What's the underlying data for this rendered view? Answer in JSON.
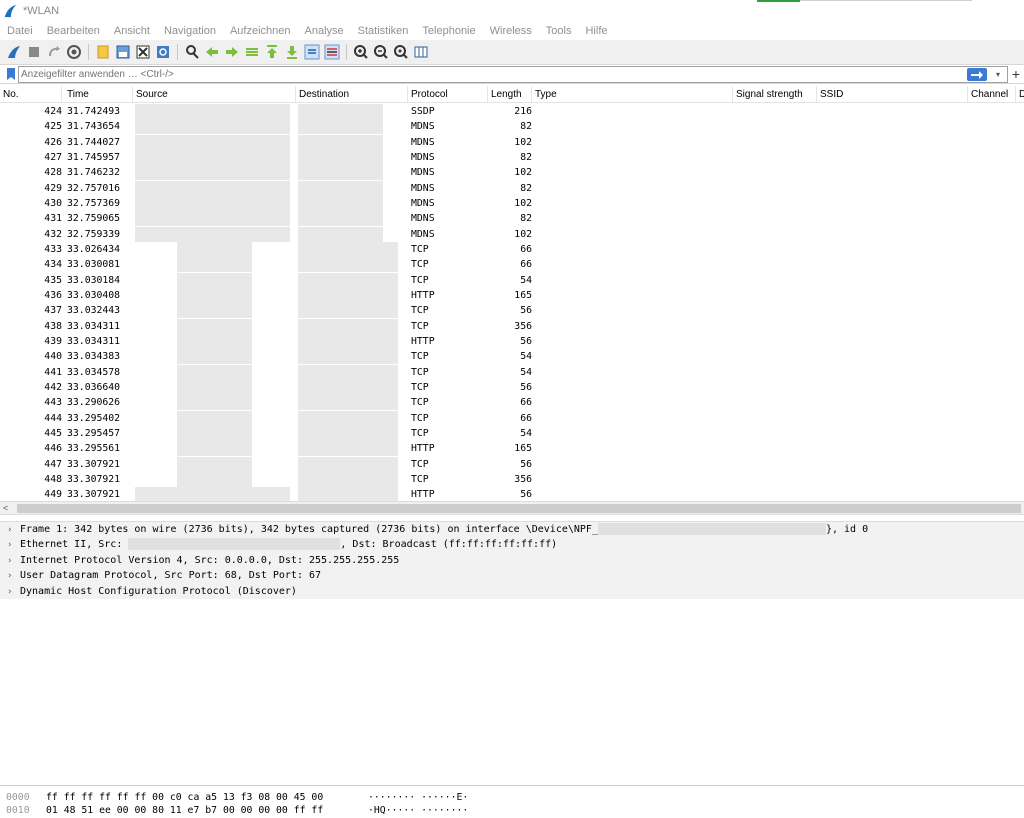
{
  "window": {
    "title": "*WLAN"
  },
  "menu": [
    "Datei",
    "Bearbeiten",
    "Ansicht",
    "Navigation",
    "Aufzeichnen",
    "Analyse",
    "Statistiken",
    "Telephonie",
    "Wireless",
    "Tools",
    "Hilfe"
  ],
  "filter": {
    "placeholder": "Anzeigefilter anwenden … <Ctrl-/>"
  },
  "columns": [
    "No.",
    "Time",
    "Source",
    "Destination",
    "Protocol",
    "Length",
    "Type",
    "Signal strength",
    "SSID",
    "Channel",
    "D"
  ],
  "packets": [
    {
      "no": "424",
      "time": "31.742493",
      "protocol": "SSDP",
      "length": "216"
    },
    {
      "no": "425",
      "time": "31.743654",
      "protocol": "MDNS",
      "length": "82"
    },
    {
      "no": "426",
      "time": "31.744027",
      "protocol": "MDNS",
      "length": "102"
    },
    {
      "no": "427",
      "time": "31.745957",
      "protocol": "MDNS",
      "length": "82"
    },
    {
      "no": "428",
      "time": "31.746232",
      "protocol": "MDNS",
      "length": "102"
    },
    {
      "no": "429",
      "time": "32.757016",
      "protocol": "MDNS",
      "length": "82"
    },
    {
      "no": "430",
      "time": "32.757369",
      "protocol": "MDNS",
      "length": "102"
    },
    {
      "no": "431",
      "time": "32.759065",
      "protocol": "MDNS",
      "length": "82"
    },
    {
      "no": "432",
      "time": "32.759339",
      "protocol": "MDNS",
      "length": "102"
    },
    {
      "no": "433",
      "time": "33.026434",
      "protocol": "TCP",
      "length": "66"
    },
    {
      "no": "434",
      "time": "33.030081",
      "protocol": "TCP",
      "length": "66"
    },
    {
      "no": "435",
      "time": "33.030184",
      "protocol": "TCP",
      "length": "54"
    },
    {
      "no": "436",
      "time": "33.030408",
      "protocol": "HTTP",
      "length": "165"
    },
    {
      "no": "437",
      "time": "33.032443",
      "protocol": "TCP",
      "length": "56"
    },
    {
      "no": "438",
      "time": "33.034311",
      "protocol": "TCP",
      "length": "356"
    },
    {
      "no": "439",
      "time": "33.034311",
      "protocol": "HTTP",
      "length": "56"
    },
    {
      "no": "440",
      "time": "33.034383",
      "protocol": "TCP",
      "length": "54"
    },
    {
      "no": "441",
      "time": "33.034578",
      "protocol": "TCP",
      "length": "54"
    },
    {
      "no": "442",
      "time": "33.036640",
      "protocol": "TCP",
      "length": "56"
    },
    {
      "no": "443",
      "time": "33.290626",
      "protocol": "TCP",
      "length": "66"
    },
    {
      "no": "444",
      "time": "33.295402",
      "protocol": "TCP",
      "length": "66"
    },
    {
      "no": "445",
      "time": "33.295457",
      "protocol": "TCP",
      "length": "54"
    },
    {
      "no": "446",
      "time": "33.295561",
      "protocol": "HTTP",
      "length": "165"
    },
    {
      "no": "447",
      "time": "33.307921",
      "protocol": "TCP",
      "length": "56"
    },
    {
      "no": "448",
      "time": "33.307921",
      "protocol": "TCP",
      "length": "356"
    },
    {
      "no": "449",
      "time": "33.307921",
      "protocol": "HTTP",
      "length": "56"
    }
  ],
  "details": {
    "frame_prefix": "Frame 1: 342 bytes on wire (2736 bits), 342 bytes captured (2736 bits) on interface \\Device\\NPF_",
    "frame_suffix": "}, id 0",
    "ethernet_prefix": "Ethernet II, Src:",
    "ethernet_suffix": ", Dst: Broadcast (ff:ff:ff:ff:ff:ff)",
    "ip": "Internet Protocol Version 4, Src: 0.0.0.0, Dst: 255.255.255.255",
    "udp": "User Datagram Protocol, Src Port: 68, Dst Port: 67",
    "dhcp": "Dynamic Host Configuration Protocol (Discover)"
  },
  "bytes": [
    {
      "offset": "0000",
      "hex": "ff ff ff ff ff ff 00 c0  ca a5 13 f3 08 00 45 00",
      "ascii": "········ ······E·"
    },
    {
      "offset": "0010",
      "hex": "01 48 51 ee 00 00 80 11  e7 b7 00 00 00 00 ff ff",
      "ascii": "·HQ····· ········"
    }
  ]
}
